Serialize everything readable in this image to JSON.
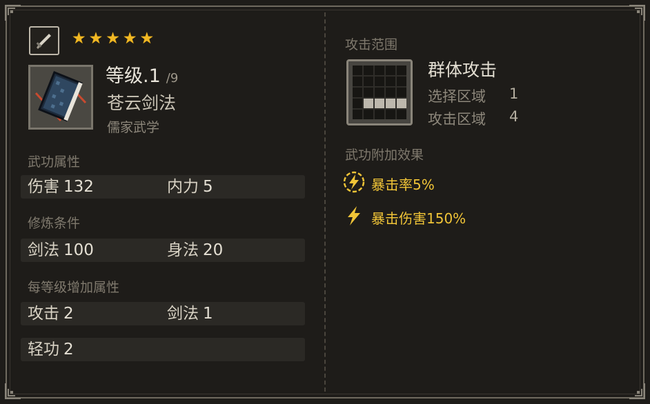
{
  "weapon": {
    "icon": "sword-icon"
  },
  "stars": {
    "count": 5,
    "color": "#f2b823",
    "glyph": "★"
  },
  "skill": {
    "level_label": "等级",
    "level_value": ".1",
    "level_max": "/9",
    "name": "苍云剑法",
    "school": "儒家武学",
    "icon": "book-icon"
  },
  "attributes": {
    "label": "武功属性",
    "items": [
      {
        "name": "伤害",
        "value": "132"
      },
      {
        "name": "内力",
        "value": "5"
      }
    ]
  },
  "requirements": {
    "label": "修炼条件",
    "items": [
      {
        "name": "剑法",
        "value": "100"
      },
      {
        "name": "身法",
        "value": "20"
      }
    ]
  },
  "per_level": {
    "label": "每等级增加属性",
    "items": [
      {
        "name": "攻击",
        "value": "2"
      },
      {
        "name": "剑法",
        "value": "1"
      },
      {
        "name": "轻功",
        "value": "2"
      }
    ]
  },
  "attack_range": {
    "label": "攻击范围",
    "type": "群体攻击",
    "select_area_label": "选择区域",
    "select_area_value": "1",
    "attack_area_label": "攻击区域",
    "attack_area_value": "4",
    "grid_on_cells": [
      16,
      17,
      18,
      19
    ]
  },
  "effects": {
    "label": "武功附加效果",
    "items": [
      {
        "icon": "lightning-circle-icon",
        "text": "暴击率5%"
      },
      {
        "icon": "lightning-icon",
        "text": "暴击伤害150%"
      }
    ],
    "color": "#f0c437"
  }
}
